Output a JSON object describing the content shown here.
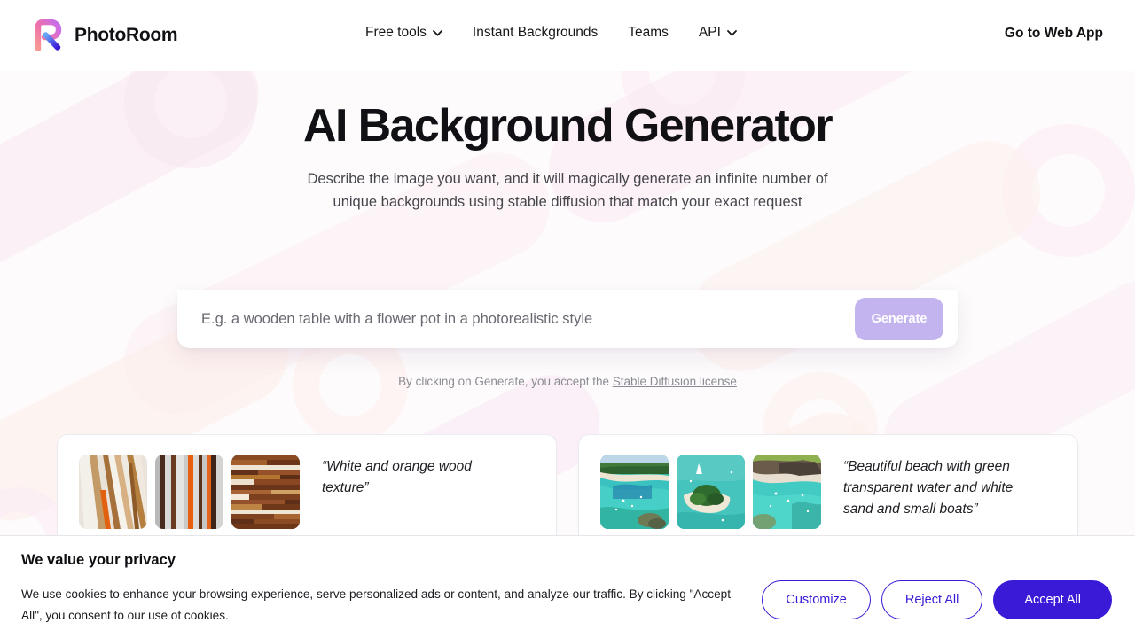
{
  "header": {
    "brand_name": "PhotoRoom",
    "logo_icon": "photoroom-r-logo-icon",
    "nav": [
      {
        "label": "Free tools",
        "icon": "chevron-down-icon",
        "has_caret": true
      },
      {
        "label": "Instant Backgrounds",
        "icon": "",
        "has_caret": false
      },
      {
        "label": "Teams",
        "icon": "",
        "has_caret": false
      },
      {
        "label": "API",
        "icon": "chevron-down-icon",
        "has_caret": true
      }
    ],
    "cta_label": "Go to Web App"
  },
  "hero": {
    "title": "AI Background Generator",
    "subtitle": "Describe the image you want, and it will magically generate an infinite number of unique backgrounds using stable diffusion that match your exact request"
  },
  "prompt": {
    "value": "",
    "placeholder": "E.g. a wooden table with a flower pot in a photorealistic style",
    "generate_label": "Generate",
    "generate_color": "#c3b4f0",
    "disclaimer_prefix": "By clicking on Generate, you accept the ",
    "disclaimer_link": "Stable Diffusion license"
  },
  "examples": [
    {
      "quote": "“White and orange wood texture”",
      "thumbs": [
        "wood-texture-thumb-1",
        "wood-texture-thumb-2",
        "wood-texture-thumb-3"
      ]
    },
    {
      "quote": "“Beautiful beach with green transparent water and white sand and small boats”",
      "thumbs": [
        "beach-thumb-1",
        "beach-thumb-2",
        "beach-thumb-3"
      ]
    }
  ],
  "cookie_banner": {
    "title": "We value your privacy",
    "body": "We use cookies to enhance your browsing experience, serve personalized ads or content, and analyze our traffic. By clicking \"Accept All\", you consent to our use of cookies.",
    "customize_label": "Customize",
    "reject_label": "Reject All",
    "accept_label": "Accept All",
    "accent_color": "#3a1ad6"
  }
}
